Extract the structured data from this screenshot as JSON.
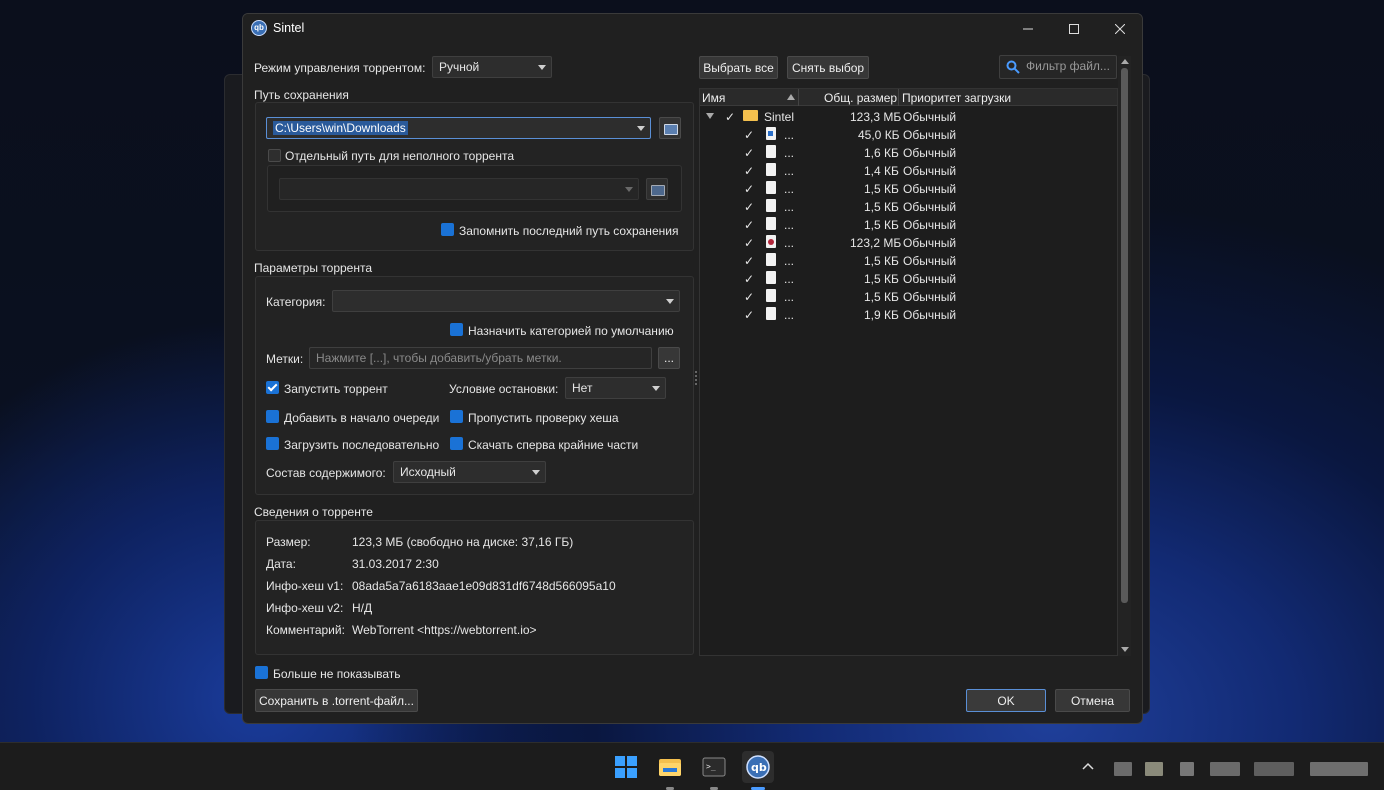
{
  "window": {
    "title": "Sintel",
    "app_icon": "qb"
  },
  "left": {
    "mode_label": "Режим управления торрентом:",
    "mode_value": "Ручной",
    "save_group_title": "Путь сохранения",
    "save_path": "C:\\Users\\win\\Downloads",
    "incomplete_label": "Отдельный путь для неполного торрента",
    "incomplete_path": "",
    "remember_label": "Запомнить последний путь сохранения",
    "params_title": "Параметры торрента",
    "category_label": "Категория:",
    "category_value": "",
    "default_category_label": "Назначить категорией по умолчанию",
    "tags_label": "Метки:",
    "tags_placeholder": "Нажмите [...], чтобы добавить/убрать метки.",
    "tags_button": "...",
    "start_label": "Запустить торрент",
    "stop_cond_label": "Условие остановки:",
    "stop_cond_value": "Нет",
    "add_top_label": "Добавить в начало очереди",
    "skip_hash_label": "Пропустить проверку хеша",
    "sequential_label": "Загрузить последовательно",
    "first_last_label": "Скачать сперва крайние части",
    "layout_label": "Состав содержимого:",
    "layout_value": "Исходный",
    "info_title": "Сведения о торренте",
    "info": [
      {
        "key": "Размер:",
        "value": "123,3 МБ (свободно на диске: 37,16 ГБ)"
      },
      {
        "key": "Дата:",
        "value": "31.03.2017 2:30"
      },
      {
        "key": "Инфо-хеш v1:",
        "value": "08ada5a7a6183aae1e09d831df6748d566095a10"
      },
      {
        "key": "Инфо-хеш v2:",
        "value": "Н/Д"
      },
      {
        "key": "Комментарий:",
        "value": "WebTorrent <https://webtorrent.io>"
      }
    ],
    "dont_show_label": "Больше не показывать",
    "save_torrent_button": "Сохранить в .torrent-файл..."
  },
  "right": {
    "select_all": "Выбрать все",
    "select_none": "Снять выбор",
    "filter_placeholder": "Фильтр файл...",
    "columns": [
      "Имя",
      "Общ. размер",
      "Приоритет загрузки"
    ],
    "root": {
      "name": "Sintel",
      "size": "123,3 МБ",
      "priority": "Обычный"
    },
    "files": [
      {
        "name": "...",
        "size": "45,0 КБ",
        "priority": "Обычный",
        "icon": "image-file-icon"
      },
      {
        "name": "...",
        "size": "1,6 КБ",
        "priority": "Обычный",
        "icon": "file-icon"
      },
      {
        "name": "...",
        "size": "1,4 КБ",
        "priority": "Обычный",
        "icon": "file-icon"
      },
      {
        "name": "...",
        "size": "1,5 КБ",
        "priority": "Обычный",
        "icon": "file-icon"
      },
      {
        "name": "...",
        "size": "1,5 КБ",
        "priority": "Обычный",
        "icon": "file-icon"
      },
      {
        "name": "...",
        "size": "1,5 КБ",
        "priority": "Обычный",
        "icon": "file-icon"
      },
      {
        "name": "...",
        "size": "123,2 МБ",
        "priority": "Обычный",
        "icon": "video-file-icon"
      },
      {
        "name": "...",
        "size": "1,5 КБ",
        "priority": "Обычный",
        "icon": "file-icon"
      },
      {
        "name": "...",
        "size": "1,5 КБ",
        "priority": "Обычный",
        "icon": "file-icon"
      },
      {
        "name": "...",
        "size": "1,5 КБ",
        "priority": "Обычный",
        "icon": "file-icon"
      },
      {
        "name": "...",
        "size": "1,9 КБ",
        "priority": "Обычный",
        "icon": "file-icon"
      }
    ]
  },
  "buttons": {
    "ok": "OK",
    "cancel": "Отмена"
  },
  "colors": {
    "accent": "#1a72d6",
    "window_bg": "#202020",
    "folder": "#f4c04e"
  }
}
